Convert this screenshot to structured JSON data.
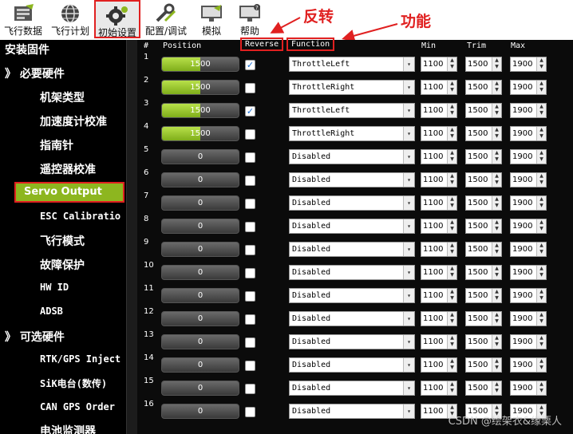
{
  "toolbar": {
    "items": [
      {
        "label": "飞行数据",
        "icon": "flight-data-icon"
      },
      {
        "label": "飞行计划",
        "icon": "globe-icon"
      },
      {
        "label": "初始设置",
        "icon": "gear-icon"
      },
      {
        "label": "配置/调试",
        "icon": "wrench-icon"
      },
      {
        "label": "模拟",
        "icon": "monitor-icon"
      },
      {
        "label": "帮助",
        "icon": "help-monitor-icon"
      }
    ],
    "active_index": 2
  },
  "annotations": {
    "reverse_note": "反转",
    "function_note": "功能"
  },
  "sidebar": {
    "install_firmware": "安装固件",
    "required_group": "》 必要硬件",
    "required_items": [
      "机架类型",
      "加速度计校准",
      "指南针",
      "遥控器校准"
    ],
    "servo_output": "Servo Output",
    "more_items": [
      "ESC Calibratio",
      "飞行模式",
      "故障保护",
      "HW ID",
      "ADSB"
    ],
    "optional_group": "》 可选硬件",
    "optional_items": [
      "RTK/GPS Inject",
      "SiK电台(数传)",
      "CAN GPS Order",
      "电池监测器"
    ]
  },
  "table": {
    "headers": {
      "num": "#",
      "position": "Position",
      "reverse": "Reverse",
      "function": "Function",
      "min": "Min",
      "trim": "Trim",
      "max": "Max"
    },
    "rows": [
      {
        "n": "1",
        "pos": "1500",
        "pos_frac": 0.5,
        "rev": true,
        "func": "ThrottleLeft",
        "min": "1100",
        "trim": "1500",
        "max": "1900"
      },
      {
        "n": "2",
        "pos": "1500",
        "pos_frac": 0.5,
        "rev": false,
        "func": "ThrottleRight",
        "min": "1100",
        "trim": "1500",
        "max": "1900"
      },
      {
        "n": "3",
        "pos": "1500",
        "pos_frac": 0.5,
        "rev": true,
        "func": "ThrottleLeft",
        "min": "1100",
        "trim": "1500",
        "max": "1900"
      },
      {
        "n": "4",
        "pos": "1500",
        "pos_frac": 0.5,
        "rev": false,
        "func": "ThrottleRight",
        "min": "1100",
        "trim": "1500",
        "max": "1900"
      },
      {
        "n": "5",
        "pos": "0",
        "pos_frac": 0,
        "rev": false,
        "func": "Disabled",
        "min": "1100",
        "trim": "1500",
        "max": "1900"
      },
      {
        "n": "6",
        "pos": "0",
        "pos_frac": 0,
        "rev": false,
        "func": "Disabled",
        "min": "1100",
        "trim": "1500",
        "max": "1900"
      },
      {
        "n": "7",
        "pos": "0",
        "pos_frac": 0,
        "rev": false,
        "func": "Disabled",
        "min": "1100",
        "trim": "1500",
        "max": "1900"
      },
      {
        "n": "8",
        "pos": "0",
        "pos_frac": 0,
        "rev": false,
        "func": "Disabled",
        "min": "1100",
        "trim": "1500",
        "max": "1900"
      },
      {
        "n": "9",
        "pos": "0",
        "pos_frac": 0,
        "rev": false,
        "func": "Disabled",
        "min": "1100",
        "trim": "1500",
        "max": "1900"
      },
      {
        "n": "10",
        "pos": "0",
        "pos_frac": 0,
        "rev": false,
        "func": "Disabled",
        "min": "1100",
        "trim": "1500",
        "max": "1900"
      },
      {
        "n": "11",
        "pos": "0",
        "pos_frac": 0,
        "rev": false,
        "func": "Disabled",
        "min": "1100",
        "trim": "1500",
        "max": "1900"
      },
      {
        "n": "12",
        "pos": "0",
        "pos_frac": 0,
        "rev": false,
        "func": "Disabled",
        "min": "1100",
        "trim": "1500",
        "max": "1900"
      },
      {
        "n": "13",
        "pos": "0",
        "pos_frac": 0,
        "rev": false,
        "func": "Disabled",
        "min": "1100",
        "trim": "1500",
        "max": "1900"
      },
      {
        "n": "14",
        "pos": "0",
        "pos_frac": 0,
        "rev": false,
        "func": "Disabled",
        "min": "1100",
        "trim": "1500",
        "max": "1900"
      },
      {
        "n": "15",
        "pos": "0",
        "pos_frac": 0,
        "rev": false,
        "func": "Disabled",
        "min": "1100",
        "trim": "1500",
        "max": "1900"
      },
      {
        "n": "16",
        "pos": "0",
        "pos_frac": 0,
        "rev": false,
        "func": "Disabled",
        "min": "1100",
        "trim": "1500",
        "max": "1900"
      }
    ]
  },
  "watermark": "CSDN @绘架衣&缘栗人",
  "colors": {
    "accent_green": "#8db61f",
    "highlight_red": "#e02020"
  }
}
